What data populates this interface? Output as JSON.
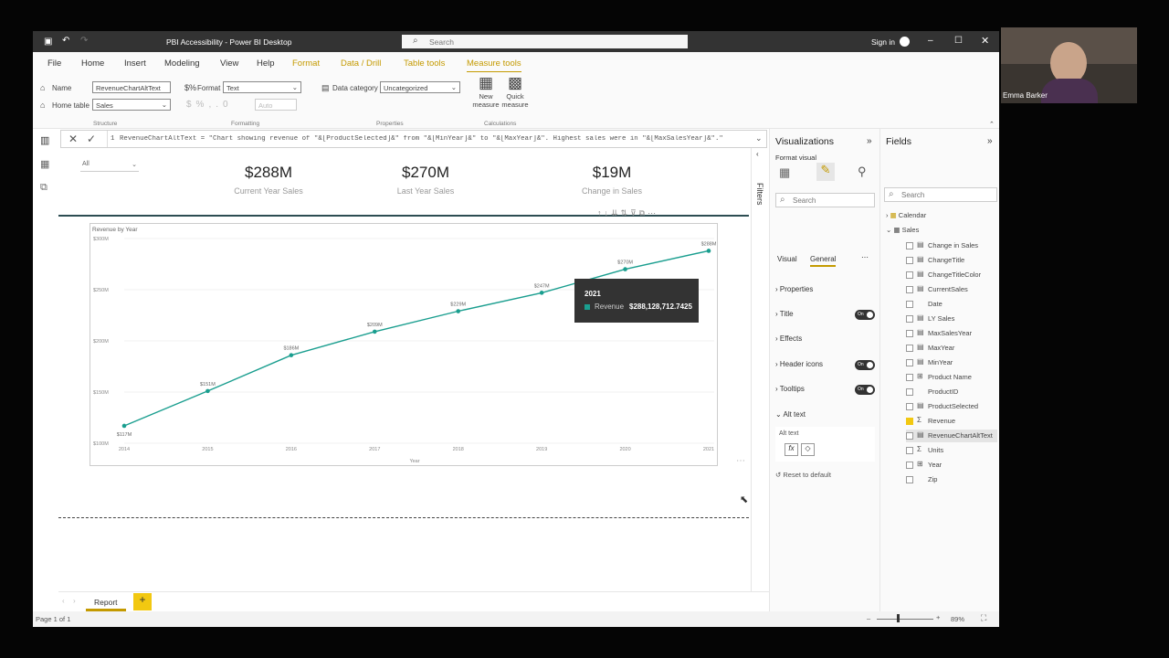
{
  "window": {
    "title": "PBI Accessibility - Power BI Desktop",
    "search_placeholder": "Search",
    "signin": "Sign in"
  },
  "tabs": [
    "File",
    "Home",
    "Insert",
    "Modeling",
    "View",
    "Help",
    "Format",
    "Data / Drill",
    "Table tools",
    "Measure tools"
  ],
  "ribbon": {
    "name_label": "Name",
    "name_value": "RevenueChartAltText",
    "home_table_label": "Home table",
    "home_table_value": "Sales",
    "format_label": "Format",
    "format_value": "Text",
    "auto_value": "Auto",
    "data_category_label": "Data category",
    "data_category_value": "Uncategorized",
    "new_measure": "New measure",
    "quick_measure": "Quick measure",
    "groups": [
      "Structure",
      "Formatting",
      "Properties",
      "Calculations"
    ]
  },
  "formula": {
    "line": "1",
    "text": "RevenueChartAltText = \"Chart showing revenue of \"&[ProductSelected]&\" from \"&[MinYear]&\" to \"&[MaxYear]&\". Highest sales were in \"&[MaxSalesYear]&\".\""
  },
  "slicer": {
    "value": "All"
  },
  "cards": [
    {
      "value": "$288M",
      "label": "Current Year Sales"
    },
    {
      "value": "$270M",
      "label": "Last Year Sales"
    },
    {
      "value": "$19M",
      "label": "Change in Sales"
    }
  ],
  "chart_data": {
    "type": "line",
    "title": "Revenue by Year",
    "xlabel": "Year",
    "ylabel": "",
    "x": [
      2014,
      2015,
      2016,
      2017,
      2018,
      2019,
      2020,
      2021
    ],
    "series": [
      {
        "name": "Revenue",
        "values": [
          117,
          151,
          186,
          209,
          229,
          247,
          270,
          288
        ]
      }
    ],
    "data_labels": [
      "$117M",
      "$151M",
      "$186M",
      "$209M",
      "$229M",
      "$247M",
      "$270M",
      "$288M"
    ],
    "y_ticks": [
      {
        "v": 100,
        "label": "$100M"
      },
      {
        "v": 150,
        "label": "$150M"
      },
      {
        "v": 200,
        "label": "$200M"
      },
      {
        "v": 250,
        "label": "$250M"
      },
      {
        "v": 300,
        "label": "$300M"
      }
    ],
    "ylim": [
      100,
      300
    ],
    "color": "#1a9e8f",
    "grid": true
  },
  "tooltip": {
    "year": "2021",
    "series": "Revenue",
    "value": "$288,128,712.7425"
  },
  "filters_label": "Filters",
  "visualizations": {
    "header": "Visualizations",
    "format_visual": "Format visual",
    "search_placeholder": "Search",
    "tab_visual": "Visual",
    "tab_general": "General",
    "sections": [
      {
        "label": "Properties",
        "toggle": ""
      },
      {
        "label": "Title",
        "toggle": "On"
      },
      {
        "label": "Effects",
        "toggle": ""
      },
      {
        "label": "Header icons",
        "toggle": "On"
      },
      {
        "label": "Tooltips",
        "toggle": "On"
      }
    ],
    "alt_text_section": "Alt text",
    "alt_text_label": "Alt text",
    "reset": "Reset to default"
  },
  "fields": {
    "header": "Fields",
    "search_placeholder": "Search",
    "tables": [
      "Calendar",
      "Sales"
    ],
    "items": [
      {
        "label": "Change in Sales",
        "icon": "calc",
        "checked": false
      },
      {
        "label": "ChangeTitle",
        "icon": "calc",
        "checked": false
      },
      {
        "label": "ChangeTitleColor",
        "icon": "calc",
        "checked": false
      },
      {
        "label": "CurrentSales",
        "icon": "calc",
        "checked": false
      },
      {
        "label": "Date",
        "icon": "",
        "checked": false
      },
      {
        "label": "LY Sales",
        "icon": "calc",
        "checked": false
      },
      {
        "label": "MaxSalesYear",
        "icon": "calc",
        "checked": false
      },
      {
        "label": "MaxYear",
        "icon": "calc",
        "checked": false
      },
      {
        "label": "MinYear",
        "icon": "calc",
        "checked": false
      },
      {
        "label": "Product Name",
        "icon": "hier",
        "checked": false
      },
      {
        "label": "ProductID",
        "icon": "",
        "checked": false
      },
      {
        "label": "ProductSelected",
        "icon": "calc",
        "checked": false
      },
      {
        "label": "Revenue",
        "icon": "sigma",
        "checked": true
      },
      {
        "label": "RevenueChartAltText",
        "icon": "calc",
        "checked": false
      },
      {
        "label": "Units",
        "icon": "sigma",
        "checked": false
      },
      {
        "label": "Year",
        "icon": "hier",
        "checked": false
      },
      {
        "label": "Zip",
        "icon": "",
        "checked": false
      }
    ]
  },
  "page_tab": "Report",
  "status": {
    "page": "Page 1 of 1",
    "zoom": "89%"
  },
  "webcam": {
    "name": "Emma Barker"
  }
}
